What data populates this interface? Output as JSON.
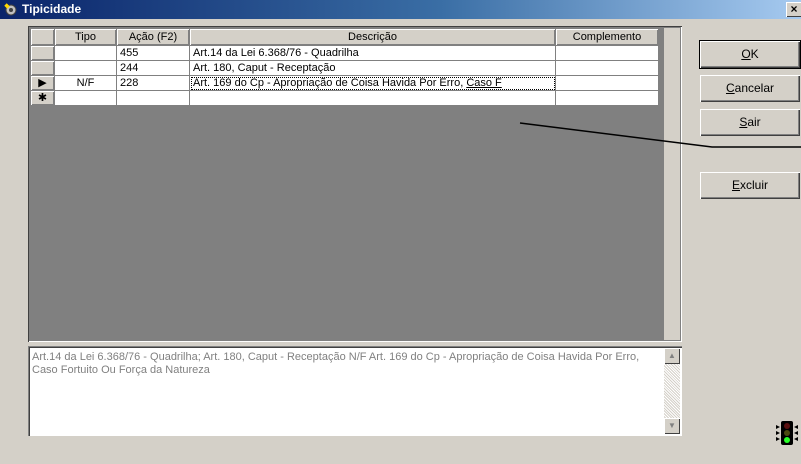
{
  "window": {
    "title": "Tipicidade",
    "close_glyph": "×"
  },
  "grid": {
    "columns": [
      "Tipo",
      "Ação (F2)",
      "Descrição",
      "Complemento"
    ],
    "rows": [
      {
        "selector": "",
        "tipo": "",
        "acao": "455",
        "descricao": "Art.14 da Lei 6.368/76 - Quadrilha",
        "complemento": ""
      },
      {
        "selector": "",
        "tipo": "",
        "acao": "244",
        "descricao": "Art. 180, Caput - Receptação",
        "complemento": ""
      },
      {
        "selector": "▶",
        "tipo": "N/F",
        "acao": "228",
        "descricao_main": "Art. 169 do Cp - Apropriação de Coisa Havida Por Erro, ",
        "descricao_tail": "Caso F",
        "complemento": ""
      },
      {
        "selector": "✱",
        "tipo": "",
        "acao": "",
        "descricao": "",
        "complemento": ""
      }
    ]
  },
  "memo": {
    "text": "Art.14 da Lei 6.368/76 - Quadrilha; Art. 180, Caput - Receptação N/F Art. 169 do Cp - Apropriação de Coisa Havida Por Erro, Caso Fortuito Ou Força da Natureza",
    "scroll_up_glyph": "▲",
    "scroll_down_glyph": "▼"
  },
  "buttons": {
    "ok": {
      "accel": "O",
      "rest": "K"
    },
    "cancel": {
      "accel": "C",
      "rest": "ancelar"
    },
    "sair": {
      "accel": "S",
      "rest": "air"
    },
    "excluir": {
      "accel": "E",
      "rest": "xcluir"
    }
  },
  "icons": {
    "title_icon": "gear-tools-icon",
    "status_icon": "traffic-light-icon"
  },
  "colors": {
    "titlebar_start": "#0a246a",
    "titlebar_end": "#a6caf0",
    "window_face": "#d4d0c8",
    "grid_background": "#808080"
  }
}
